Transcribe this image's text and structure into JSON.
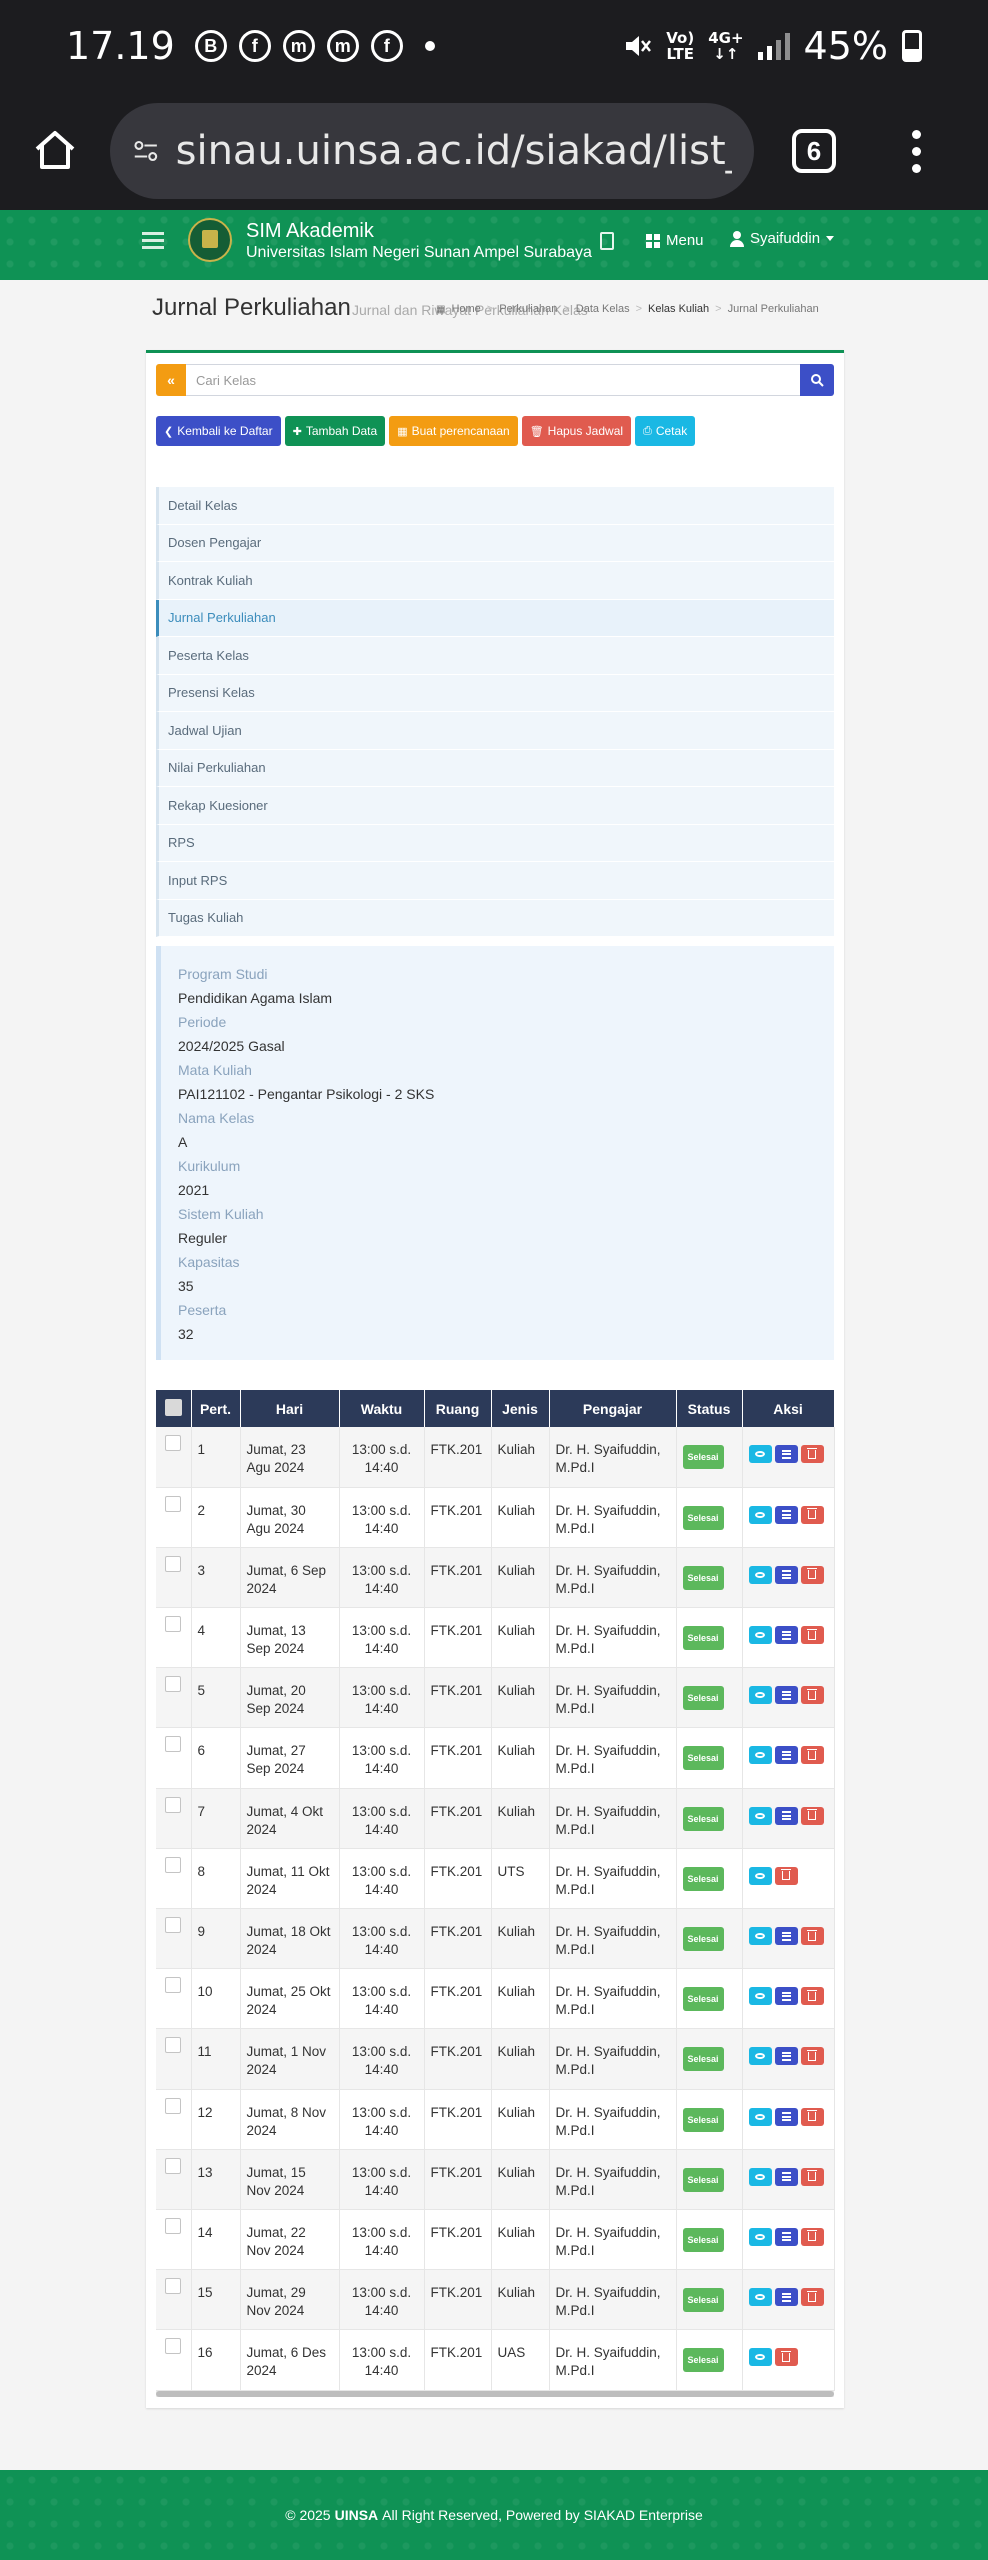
{
  "statusbar": {
    "time": "17.19",
    "notif_icons": [
      "B",
      "f",
      "m",
      "m",
      "f"
    ],
    "network_top": "Vo)",
    "network_bottom": "LTE",
    "gen_top": "4G+",
    "gen_bottom": "↓↑",
    "battery": "45%"
  },
  "browser": {
    "url": "sinau.uinsa.ac.id/siakad/list_perkuliahan",
    "tab_count": "6"
  },
  "header": {
    "app_title": "SIM Akademik",
    "university": "Universitas Islam Negeri Sunan Ampel Surabaya",
    "menu_label": "Menu",
    "user_name": "Syaifuddin"
  },
  "page": {
    "title": "Jurnal Perkuliahan",
    "subtitle": "Jurnal dan Riwayat Perkuliahan Kelas",
    "breadcrumb": [
      "Home",
      "Perkuliahan",
      "Data Kelas",
      "Kelas Kuliah",
      "Jurnal Perkuliahan"
    ]
  },
  "search": {
    "placeholder": "Cari Kelas",
    "back_glyph": "«"
  },
  "actions": {
    "back": "Kembali ke Daftar",
    "add": "Tambah Data",
    "plan": "Buat perencanaan",
    "delete_schedule": "Hapus Jadwal",
    "print": "Cetak"
  },
  "nav": [
    "Detail Kelas",
    "Dosen Pengajar",
    "Kontrak Kuliah",
    "Jurnal Perkuliahan",
    "Peserta Kelas",
    "Presensi Kelas",
    "Jadwal Ujian",
    "Nilai Perkuliahan",
    "Rekap Kuesioner",
    "RPS",
    "Input RPS",
    "Tugas Kuliah"
  ],
  "nav_active_index": 3,
  "info": [
    {
      "label": "Program Studi",
      "value": "Pendidikan Agama Islam"
    },
    {
      "label": "Periode",
      "value": "2024/2025 Gasal"
    },
    {
      "label": "Mata Kuliah",
      "value": "PAI121102 - Pengantar Psikologi - 2 SKS"
    },
    {
      "label": "Nama Kelas",
      "value": "A"
    },
    {
      "label": "Kurikulum",
      "value": "2021"
    },
    {
      "label": "Sistem Kuliah",
      "value": "Reguler"
    },
    {
      "label": "Kapasitas",
      "value": "35"
    },
    {
      "label": "Peserta",
      "value": "32"
    }
  ],
  "table": {
    "columns": [
      "",
      "Pert.",
      "Hari",
      "Waktu",
      "Ruang",
      "Jenis",
      "Pengajar",
      "Status",
      "Aksi"
    ],
    "rows": [
      {
        "pert": "1",
        "hari": "Jumat, 23 Agu 2024",
        "waktu": "13:00 s.d. 14:40",
        "ruang": "FTK.201",
        "jenis": "Kuliah",
        "pengajar": "Dr. H. Syaifuddin, M.Pd.I",
        "status": "Selesai",
        "edit": true
      },
      {
        "pert": "2",
        "hari": "Jumat, 30 Agu 2024",
        "waktu": "13:00 s.d. 14:40",
        "ruang": "FTK.201",
        "jenis": "Kuliah",
        "pengajar": "Dr. H. Syaifuddin, M.Pd.I",
        "status": "Selesai",
        "edit": true
      },
      {
        "pert": "3",
        "hari": "Jumat, 6 Sep 2024",
        "waktu": "13:00 s.d. 14:40",
        "ruang": "FTK.201",
        "jenis": "Kuliah",
        "pengajar": "Dr. H. Syaifuddin, M.Pd.I",
        "status": "Selesai",
        "edit": true
      },
      {
        "pert": "4",
        "hari": "Jumat, 13 Sep 2024",
        "waktu": "13:00 s.d. 14:40",
        "ruang": "FTK.201",
        "jenis": "Kuliah",
        "pengajar": "Dr. H. Syaifuddin, M.Pd.I",
        "status": "Selesai",
        "edit": true
      },
      {
        "pert": "5",
        "hari": "Jumat, 20 Sep 2024",
        "waktu": "13:00 s.d. 14:40",
        "ruang": "FTK.201",
        "jenis": "Kuliah",
        "pengajar": "Dr. H. Syaifuddin, M.Pd.I",
        "status": "Selesai",
        "edit": true
      },
      {
        "pert": "6",
        "hari": "Jumat, 27 Sep 2024",
        "waktu": "13:00 s.d. 14:40",
        "ruang": "FTK.201",
        "jenis": "Kuliah",
        "pengajar": "Dr. H. Syaifuddin, M.Pd.I",
        "status": "Selesai",
        "edit": true
      },
      {
        "pert": "7",
        "hari": "Jumat, 4 Okt 2024",
        "waktu": "13:00 s.d. 14:40",
        "ruang": "FTK.201",
        "jenis": "Kuliah",
        "pengajar": "Dr. H. Syaifuddin, M.Pd.I",
        "status": "Selesai",
        "edit": true
      },
      {
        "pert": "8",
        "hari": "Jumat, 11 Okt 2024",
        "waktu": "13:00 s.d. 14:40",
        "ruang": "FTK.201",
        "jenis": "UTS",
        "pengajar": "Dr. H. Syaifuddin, M.Pd.I",
        "status": "Selesai",
        "edit": false
      },
      {
        "pert": "9",
        "hari": "Jumat, 18 Okt 2024",
        "waktu": "13:00 s.d. 14:40",
        "ruang": "FTK.201",
        "jenis": "Kuliah",
        "pengajar": "Dr. H. Syaifuddin, M.Pd.I",
        "status": "Selesai",
        "edit": true
      },
      {
        "pert": "10",
        "hari": "Jumat, 25 Okt 2024",
        "waktu": "13:00 s.d. 14:40",
        "ruang": "FTK.201",
        "jenis": "Kuliah",
        "pengajar": "Dr. H. Syaifuddin, M.Pd.I",
        "status": "Selesai",
        "edit": true
      },
      {
        "pert": "11",
        "hari": "Jumat, 1 Nov 2024",
        "waktu": "13:00 s.d. 14:40",
        "ruang": "FTK.201",
        "jenis": "Kuliah",
        "pengajar": "Dr. H. Syaifuddin, M.Pd.I",
        "status": "Selesai",
        "edit": true
      },
      {
        "pert": "12",
        "hari": "Jumat, 8 Nov 2024",
        "waktu": "13:00 s.d. 14:40",
        "ruang": "FTK.201",
        "jenis": "Kuliah",
        "pengajar": "Dr. H. Syaifuddin, M.Pd.I",
        "status": "Selesai",
        "edit": true
      },
      {
        "pert": "13",
        "hari": "Jumat, 15 Nov 2024",
        "waktu": "13:00 s.d. 14:40",
        "ruang": "FTK.201",
        "jenis": "Kuliah",
        "pengajar": "Dr. H. Syaifuddin, M.Pd.I",
        "status": "Selesai",
        "edit": true
      },
      {
        "pert": "14",
        "hari": "Jumat, 22 Nov 2024",
        "waktu": "13:00 s.d. 14:40",
        "ruang": "FTK.201",
        "jenis": "Kuliah",
        "pengajar": "Dr. H. Syaifuddin, M.Pd.I",
        "status": "Selesai",
        "edit": true
      },
      {
        "pert": "15",
        "hari": "Jumat, 29 Nov 2024",
        "waktu": "13:00 s.d. 14:40",
        "ruang": "FTK.201",
        "jenis": "Kuliah",
        "pengajar": "Dr. H. Syaifuddin, M.Pd.I",
        "status": "Selesai",
        "edit": true
      },
      {
        "pert": "16",
        "hari": "Jumat, 6 Des 2024",
        "waktu": "13:00 s.d. 14:40",
        "ruang": "FTK.201",
        "jenis": "UAS",
        "pengajar": "Dr. H. Syaifuddin, M.Pd.I",
        "status": "Selesai",
        "edit": false
      }
    ]
  },
  "footer": {
    "prefix": "© 2025",
    "brand": "UINSA",
    "suffix": "All Right Reserved, Powered by SIAKAD Enterprise"
  },
  "colors": {
    "brand_green": "#0f9255",
    "table_header": "#2c3a59",
    "status_done": "#5cb85c",
    "btn_back": "#3c4fc7",
    "btn_add": "#0f9255",
    "btn_plan": "#f39c12",
    "btn_delete": "#e05b4f",
    "btn_print": "#1ab8e4"
  }
}
